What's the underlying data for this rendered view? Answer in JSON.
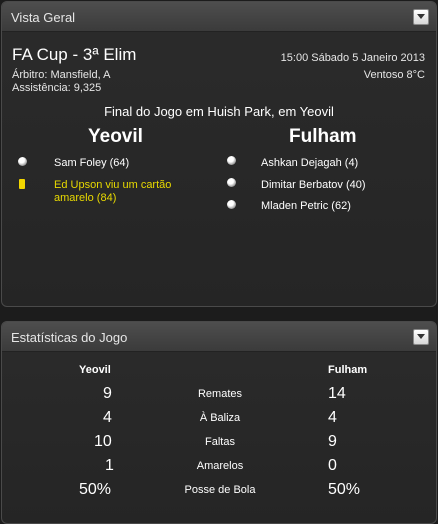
{
  "overview": {
    "title": "Vista Geral",
    "competition": "FA Cup - 3ª Elim",
    "referee": "Árbitro: Mansfield, A",
    "attendance": "Assistência: 9,325",
    "datetime": "15:00 Sábado 5 Janeiro 2013",
    "weather": "Ventoso 8°C",
    "result_line": "Final do Jogo em Huish Park, em Yeovil",
    "home_team": "Yeovil",
    "away_team": "Fulham",
    "home_events": [
      {
        "icon": "ball-icon",
        "text": "Sam Foley (64)"
      },
      {
        "icon": "yellow-card-icon",
        "text": "Ed Upson viu um cartão amarelo (84)"
      }
    ],
    "away_events": [
      {
        "icon": "ball-icon",
        "text": "Ashkan Dejagah (4)"
      },
      {
        "icon": "ball-icon",
        "text": "Dimitar Berbatov (40)"
      },
      {
        "icon": "ball-icon",
        "text": "Mladen Petric (62)"
      }
    ]
  },
  "stats": {
    "title": "Estatísticas do Jogo",
    "home_team": "Yeovil",
    "away_team": "Fulham",
    "rows": [
      {
        "label": "Remates",
        "home": "9",
        "away": "14"
      },
      {
        "label": "À Baliza",
        "home": "4",
        "away": "4"
      },
      {
        "label": "Faltas",
        "home": "10",
        "away": "9"
      },
      {
        "label": "Amarelos",
        "home": "1",
        "away": "0"
      },
      {
        "label": "Posse de Bola",
        "home": "50%",
        "away": "50%"
      }
    ]
  },
  "colors": {
    "background": "#1c1c1c",
    "panel_header": "#444444",
    "card_text": "#e8d900"
  }
}
